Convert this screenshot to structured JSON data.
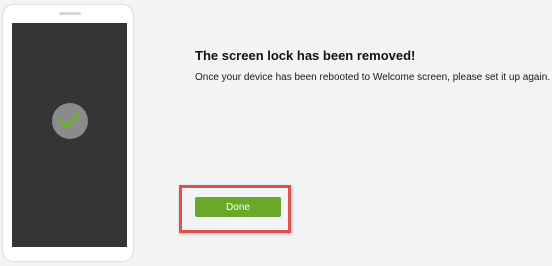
{
  "message": {
    "title": "The screen lock has been removed!",
    "subtitle": "Once your device has been rebooted to Welcome screen, please set it up again."
  },
  "actions": {
    "done_label": "Done"
  },
  "colors": {
    "accent": "#6aa829",
    "highlight": "#d9534f",
    "phone_screen": "#353535",
    "check_mark": "#6ab32e"
  },
  "icons": {
    "status": "checkmark-icon"
  }
}
